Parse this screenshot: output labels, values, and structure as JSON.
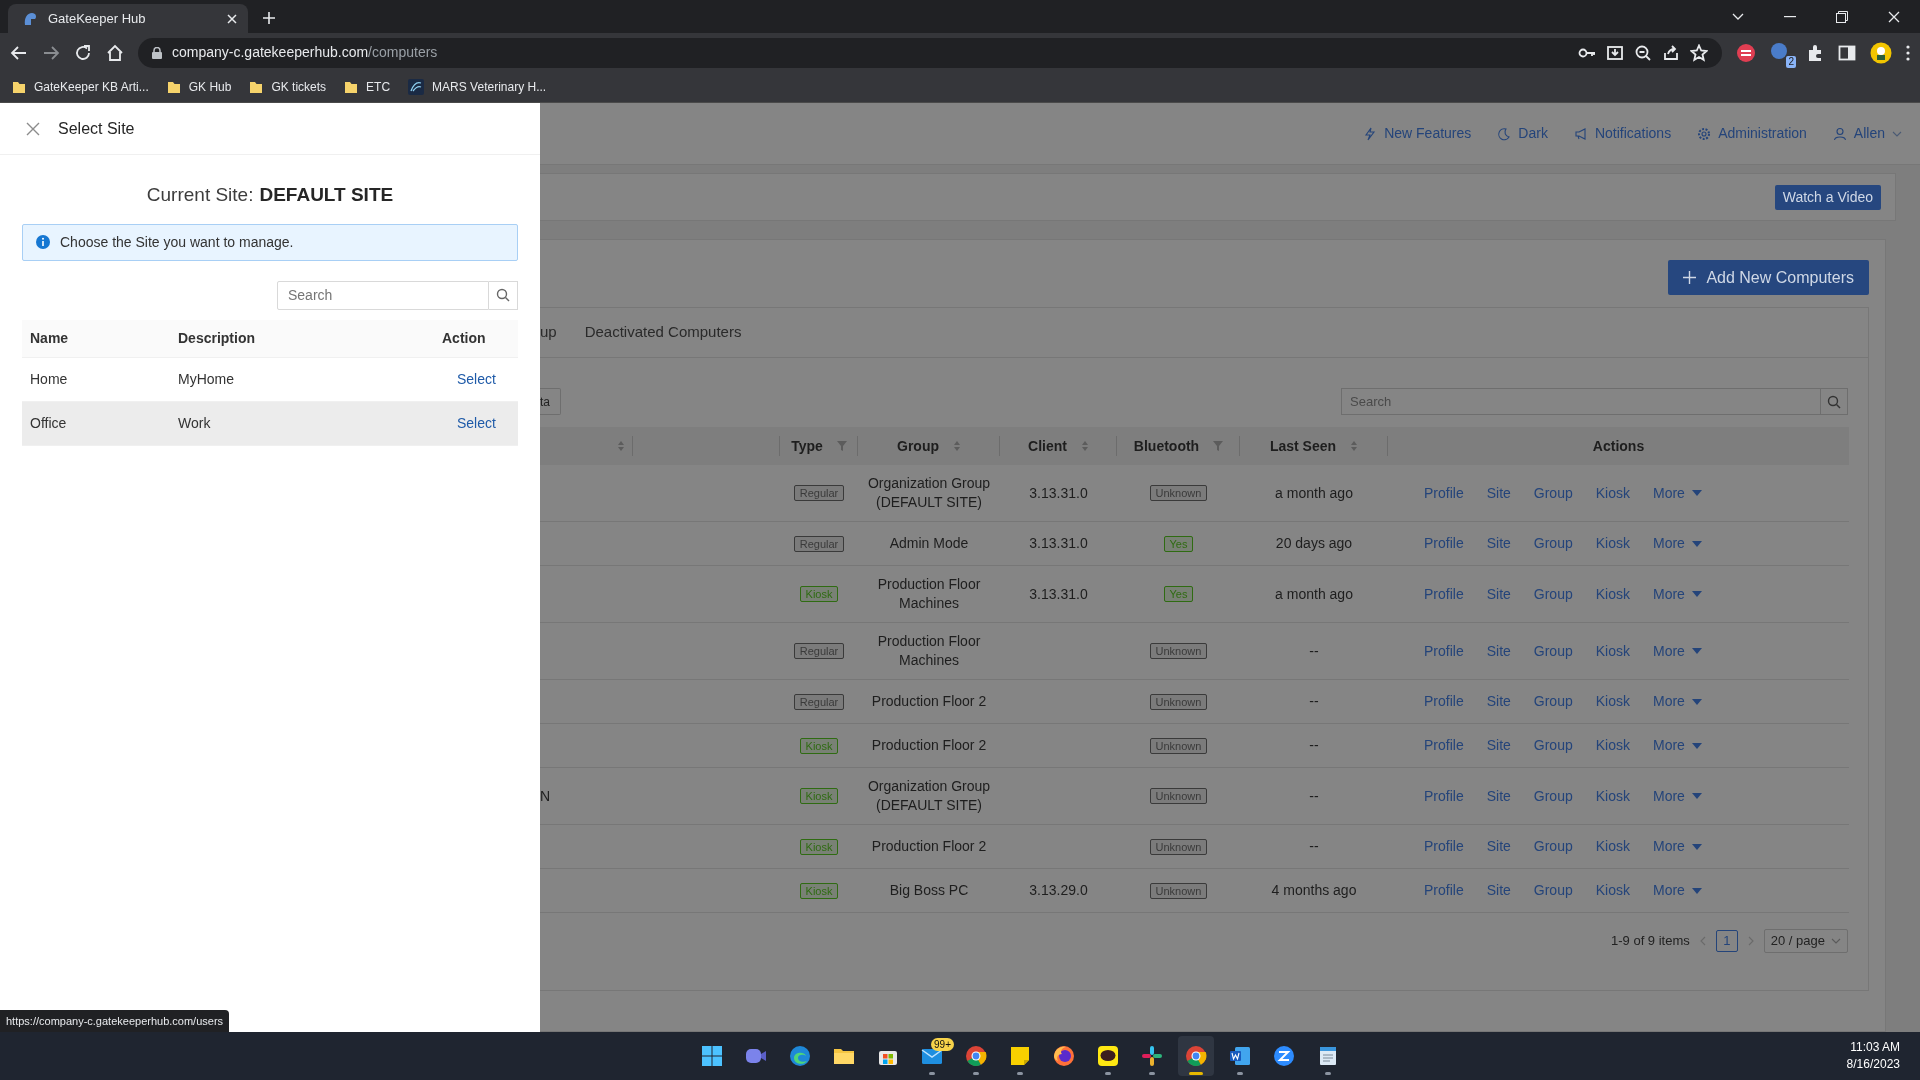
{
  "browser": {
    "tab_title": "GateKeeper Hub",
    "url_host": "company-c.gatekeeperhub.com",
    "url_path": "/computers",
    "extension_badge": "2",
    "bookmarks": [
      {
        "label": "GateKeeper KB Arti...",
        "kind": "folder"
      },
      {
        "label": "GK Hub",
        "kind": "folder"
      },
      {
        "label": "GK tickets",
        "kind": "folder"
      },
      {
        "label": "ETC",
        "kind": "folder"
      },
      {
        "label": "MARS Veterinary H...",
        "kind": "site"
      }
    ]
  },
  "drawer": {
    "title": "Select Site",
    "current_site_label": "Current Site:",
    "current_site": "DEFAULT SITE",
    "info": "Choose the Site you want to manage.",
    "search": {
      "placeholder": "Search"
    },
    "columns": [
      "Name",
      "Description",
      "Action"
    ],
    "rows": [
      {
        "name": "Home",
        "description": "MyHome",
        "action": "Select",
        "highlighted": false
      },
      {
        "name": "Office",
        "description": "Work",
        "action": "Select",
        "highlighted": true
      }
    ]
  },
  "nav_links": [
    {
      "label": "New Features",
      "kind": "features"
    },
    {
      "label": "Dark",
      "kind": "theme"
    },
    {
      "label": "Notifications",
      "kind": "notifications"
    },
    {
      "label": "Administration",
      "kind": "admin"
    },
    {
      "label": "Allen",
      "kind": "user"
    }
  ],
  "watch_video": "Watch a Video",
  "add_button": "Add New Computers",
  "tabs": [
    {
      "label": "up",
      "selected": false
    },
    {
      "label": "Deactivated Computers",
      "selected": false
    }
  ],
  "toolbar_button": "ta",
  "search": {
    "placeholder": "Search"
  },
  "table": {
    "columns": [
      {
        "sortable": true,
        "filterable": false
      },
      {
        "sortable": false,
        "filterable": false
      },
      {
        "label": "Type",
        "sortable": false,
        "filterable": true
      },
      {
        "label": "Group",
        "sortable": true,
        "filterable": false
      },
      {
        "label": "Client",
        "sortable": true,
        "filterable": false
      },
      {
        "label": "Bluetooth",
        "sortable": false,
        "filterable": true
      },
      {
        "label": "Last Seen",
        "sortable": true,
        "filterable": false
      },
      {
        "label": "Actions",
        "sortable": false,
        "filterable": false
      }
    ],
    "rows": [
      {
        "type": {
          "text": "Regular",
          "color": "#3a3a3a"
        },
        "group": "Organization Group (DEFAULT SITE)",
        "client": "3.13.31.0",
        "bluetooth": {
          "text": "Unknown",
          "color": "#3a3a3a"
        },
        "last_seen": "a month ago",
        "actions": [
          "Profile",
          "Site",
          "Group",
          "Kiosk",
          "More"
        ]
      },
      {
        "type": {
          "text": "Regular",
          "color": "#3a3a3a"
        },
        "group": "Admin Mode",
        "client": "3.13.31.0",
        "bluetooth": {
          "text": "Yes",
          "color": "#2f6b12"
        },
        "last_seen": "20 days ago",
        "actions": [
          "Profile",
          "Site",
          "Group",
          "Kiosk",
          "More"
        ]
      },
      {
        "type": {
          "text": "Kiosk",
          "color": "#2f6b12"
        },
        "group": "Production Floor Machines",
        "client": "3.13.31.0",
        "bluetooth": {
          "text": "Yes",
          "color": "#2f6b12"
        },
        "last_seen": "a month ago",
        "actions": [
          "Profile",
          "Site",
          "Group",
          "Kiosk",
          "More"
        ]
      },
      {
        "type": {
          "text": "Regular",
          "color": "#3a3a3a"
        },
        "group": "Production Floor Machines",
        "bluetooth": {
          "text": "Unknown",
          "color": "#3a3a3a"
        },
        "last_seen": "--",
        "actions": [
          "Profile",
          "Site",
          "Group",
          "Kiosk",
          "More"
        ]
      },
      {
        "type": {
          "text": "Regular",
          "color": "#3a3a3a"
        },
        "group": "Production Floor 2",
        "bluetooth": {
          "text": "Unknown",
          "color": "#3a3a3a"
        },
        "last_seen": "--",
        "actions": [
          "Profile",
          "Site",
          "Group",
          "Kiosk",
          "More"
        ]
      },
      {
        "type": {
          "text": "Kiosk",
          "color": "#2f6b12"
        },
        "group": "Production Floor 2",
        "bluetooth": {
          "text": "Unknown",
          "color": "#3a3a3a"
        },
        "last_seen": "--",
        "actions": [
          "Profile",
          "Site",
          "Group",
          "Kiosk",
          "More"
        ]
      },
      {
        "column_1": "N",
        "type": {
          "text": "Kiosk",
          "color": "#2f6b12"
        },
        "group": "Organization Group (DEFAULT SITE)",
        "bluetooth": {
          "text": "Unknown",
          "color": "#3a3a3a"
        },
        "last_seen": "--",
        "actions": [
          "Profile",
          "Site",
          "Group",
          "Kiosk",
          "More"
        ]
      },
      {
        "type": {
          "text": "Kiosk",
          "color": "#2f6b12"
        },
        "group": "Production Floor 2",
        "bluetooth": {
          "text": "Unknown",
          "color": "#3a3a3a"
        },
        "last_seen": "--",
        "actions": [
          "Profile",
          "Site",
          "Group",
          "Kiosk",
          "More"
        ]
      },
      {
        "type": {
          "text": "Kiosk",
          "color": "#2f6b12"
        },
        "group": "Big Boss PC",
        "client": "3.13.29.0",
        "bluetooth": {
          "text": "Unknown",
          "color": "#3a3a3a"
        },
        "last_seen": "4 months ago",
        "actions": [
          "Profile",
          "Site",
          "Group",
          "Kiosk",
          "More"
        ]
      }
    ]
  },
  "pagination": {
    "summary": "1-9 of 9 items",
    "pages": [
      {
        "label": "1",
        "selected": true
      }
    ],
    "page_size": "20 / page"
  },
  "status_url": "https://company-c.gatekeeperhub.com/users",
  "taskbar": {
    "apps": [
      {
        "kind": "start",
        "running": false,
        "active": false
      },
      {
        "kind": "meet",
        "running": false,
        "active": false
      },
      {
        "kind": "edge",
        "running": false,
        "active": false
      },
      {
        "kind": "folder",
        "running": false,
        "active": false
      },
      {
        "kind": "store",
        "running": false,
        "active": false
      },
      {
        "kind": "mail",
        "badge": "99+",
        "running": true,
        "active": false
      },
      {
        "kind": "chrome",
        "running": true,
        "active": false
      },
      {
        "kind": "notes",
        "running": true,
        "active": false
      },
      {
        "kind": "firefox",
        "running": false,
        "active": false
      },
      {
        "kind": "talk",
        "running": true,
        "active": false
      },
      {
        "kind": "slack",
        "running": true,
        "active": false
      },
      {
        "kind": "chrome",
        "running": true,
        "active": true
      },
      {
        "kind": "word",
        "running": true,
        "active": false
      },
      {
        "kind": "zoom",
        "running": false,
        "active": false
      },
      {
        "kind": "notepad",
        "running": true,
        "active": false
      }
    ],
    "time": "11:03 AM",
    "date": "8/16/2023"
  }
}
